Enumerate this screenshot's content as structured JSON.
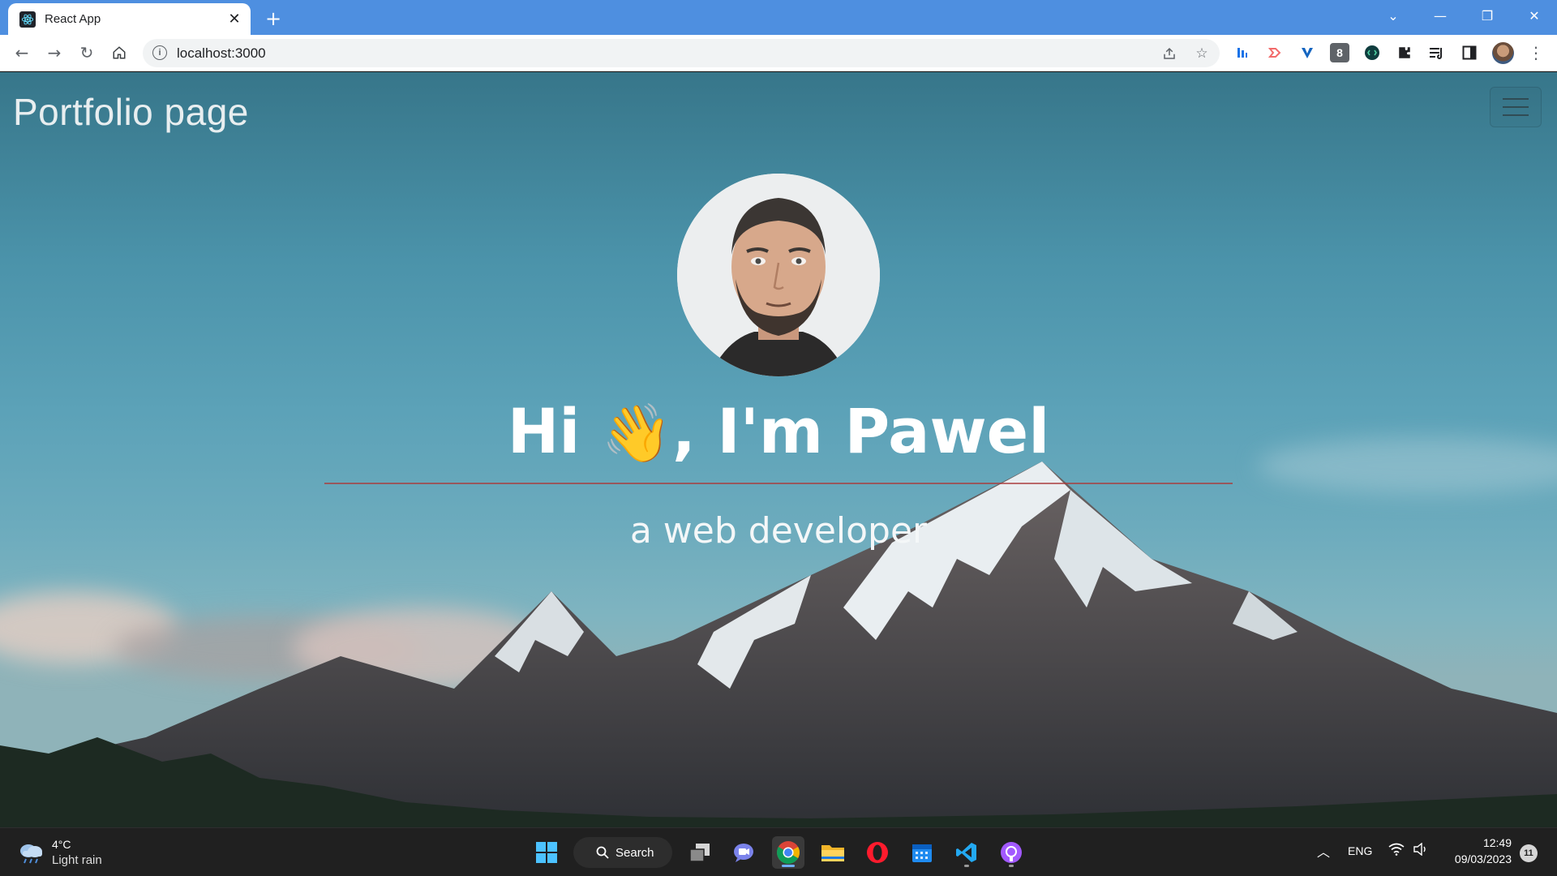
{
  "browser": {
    "tab_title": "React App",
    "tab_close_glyph": "✕",
    "new_tab_glyph": "+",
    "url": "localhost:3000",
    "window_controls": {
      "dropdown": "⌄",
      "minimize": "—",
      "restore": "❐",
      "close": "✕"
    },
    "extension_badge": "8"
  },
  "page": {
    "brand": "Portfolio page",
    "greeting_prefix": "Hi ",
    "greeting_emoji": "👋",
    "greeting_suffix": ", I'm Pawel",
    "subtitle": "a web developer"
  },
  "taskbar": {
    "weather_temp": "4°C",
    "weather_desc": "Light rain",
    "search_label": "Search",
    "language": "ENG",
    "time": "12:49",
    "date": "09/03/2023",
    "notification_count": "11"
  },
  "colors": {
    "titlebar": "#4e8fe0",
    "sky_top": "#37768a",
    "divider": "#aa3c3c",
    "taskbar": "#202020"
  },
  "icons": [
    "react-favicon",
    "back-arrow-icon",
    "forward-arrow-icon",
    "reload-icon",
    "home-icon",
    "info-icon",
    "share-icon",
    "star-icon",
    "extensions-icon",
    "reading-list-icon",
    "side-panel-icon",
    "menu-dots-icon",
    "hamburger-icon",
    "windows-start-icon",
    "search-icon",
    "chrome-icon",
    "file-explorer-icon",
    "opera-icon",
    "calendar-icon",
    "vscode-icon",
    "github-icon",
    "wifi-icon",
    "volume-icon"
  ]
}
